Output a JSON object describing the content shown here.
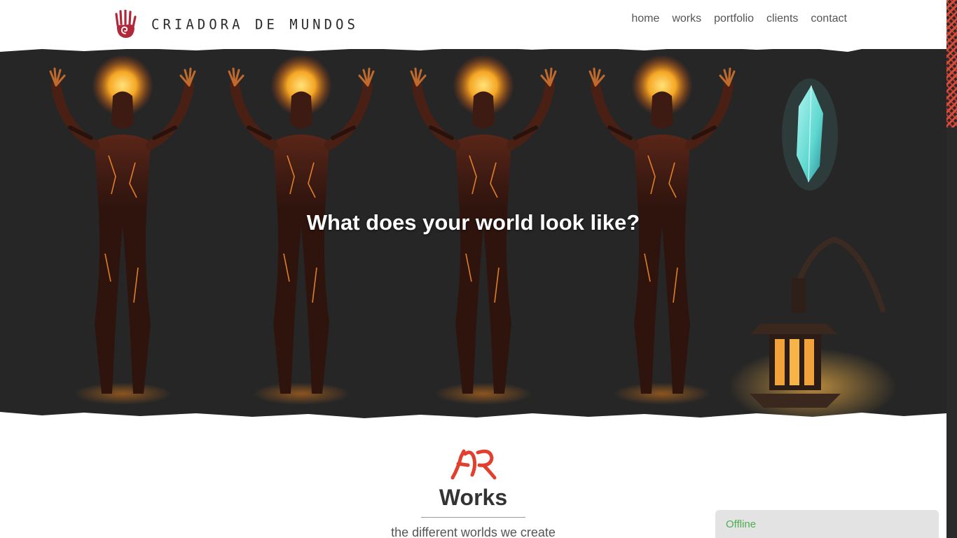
{
  "header": {
    "brand": "CRIADORA DE MUNDOS",
    "logo_icon": "red-spiral-hand-icon",
    "nav": [
      {
        "label": "home"
      },
      {
        "label": "works"
      },
      {
        "label": "portfolio"
      },
      {
        "label": "clients"
      },
      {
        "label": "contact"
      }
    ]
  },
  "hero": {
    "headline": "What does your world look like?"
  },
  "works": {
    "icon": "red-glyph-icon",
    "title": "Works",
    "subtitle": "the different worlds we create"
  },
  "chat": {
    "status": "Offline"
  },
  "colors": {
    "accent": "#d94c3a",
    "hero_bg": "#262626",
    "fire": "#f5a623",
    "crystal": "#5fd8d0",
    "chat_online": "#4caf50"
  }
}
